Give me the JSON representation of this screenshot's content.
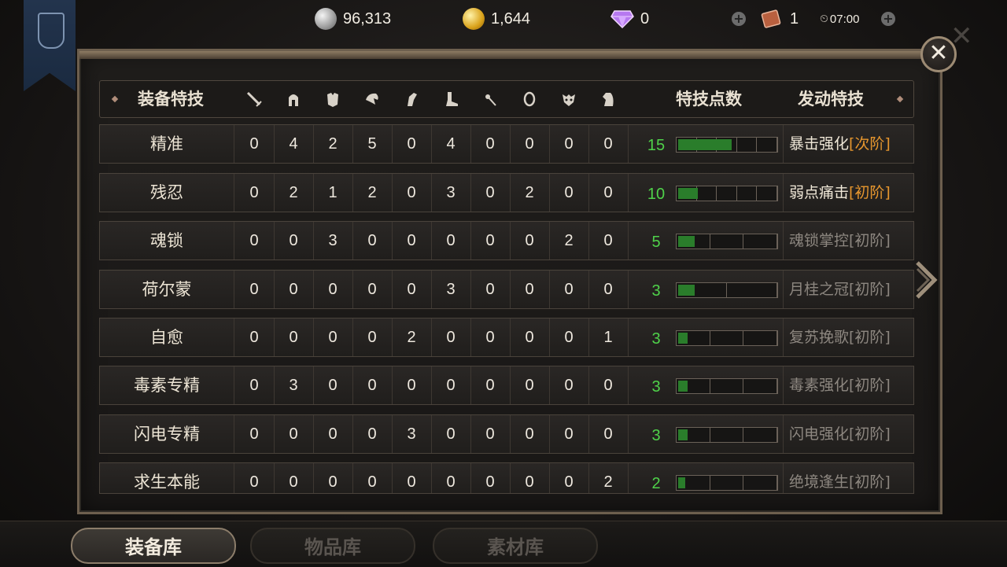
{
  "top_bar": {
    "silver": "96,313",
    "gold": "1,644",
    "gems": "0",
    "tickets": "1",
    "timer": "07:00"
  },
  "table": {
    "header": {
      "name": "装备特技",
      "points": "特技点数",
      "skill": "发动特技",
      "slot_icons": [
        "sword-icon",
        "helmet-icon",
        "chest-armor-icon",
        "pauldron-icon",
        "gauntlet-icon",
        "boot-icon",
        "weapon-flower-icon",
        "amulet-icon",
        "mask-icon",
        "horse-icon"
      ]
    },
    "rows": [
      {
        "name": "精准",
        "vals": [
          "0",
          "4",
          "2",
          "5",
          "0",
          "4",
          "0",
          "0",
          "0",
          "0"
        ],
        "pts": "15",
        "fill": 0.55,
        "segs": 5,
        "skill_main": "暴击强化",
        "skill_tier": "[次阶]",
        "active": true
      },
      {
        "name": "残忍",
        "vals": [
          "0",
          "2",
          "1",
          "2",
          "0",
          "3",
          "0",
          "2",
          "0",
          "0"
        ],
        "pts": "10",
        "fill": 0.2,
        "segs": 5,
        "skill_main": "弱点痛击",
        "skill_tier": "[初阶]",
        "active": true
      },
      {
        "name": "魂锁",
        "vals": [
          "0",
          "0",
          "3",
          "0",
          "0",
          "0",
          "0",
          "0",
          "2",
          "0"
        ],
        "pts": "5",
        "fill": 0.17,
        "segs": 3,
        "skill_main": "魂锁掌控[初阶]",
        "skill_tier": "",
        "active": false
      },
      {
        "name": "荷尔蒙",
        "vals": [
          "0",
          "0",
          "0",
          "0",
          "0",
          "3",
          "0",
          "0",
          "0",
          "0"
        ],
        "pts": "3",
        "fill": 0.17,
        "segs": 2,
        "skill_main": "月桂之冠[初阶]",
        "skill_tier": "",
        "active": false
      },
      {
        "name": "自愈",
        "vals": [
          "0",
          "0",
          "0",
          "0",
          "2",
          "0",
          "0",
          "0",
          "0",
          "1"
        ],
        "pts": "3",
        "fill": 0.1,
        "segs": 3,
        "skill_main": "复苏挽歌[初阶]",
        "skill_tier": "",
        "active": false
      },
      {
        "name": "毒素专精",
        "vals": [
          "0",
          "3",
          "0",
          "0",
          "0",
          "0",
          "0",
          "0",
          "0",
          "0"
        ],
        "pts": "3",
        "fill": 0.1,
        "segs": 3,
        "skill_main": "毒素强化[初阶]",
        "skill_tier": "",
        "active": false
      },
      {
        "name": "闪电专精",
        "vals": [
          "0",
          "0",
          "0",
          "0",
          "3",
          "0",
          "0",
          "0",
          "0",
          "0"
        ],
        "pts": "3",
        "fill": 0.1,
        "segs": 3,
        "skill_main": "闪电强化[初阶]",
        "skill_tier": "",
        "active": false
      },
      {
        "name": "求生本能",
        "vals": [
          "0",
          "0",
          "0",
          "0",
          "0",
          "0",
          "0",
          "0",
          "0",
          "2"
        ],
        "pts": "2",
        "fill": 0.07,
        "segs": 3,
        "skill_main": "绝境逢生[初阶]",
        "skill_tier": "",
        "active": false
      }
    ]
  },
  "tabs": [
    {
      "label": "装备库",
      "active": true
    },
    {
      "label": "物品库",
      "active": false
    },
    {
      "label": "素材库",
      "active": false
    }
  ],
  "colors": {
    "points_green": "#4fd24a",
    "tier_orange": "#e6962e",
    "bar_fill": "#2a7d2b"
  }
}
